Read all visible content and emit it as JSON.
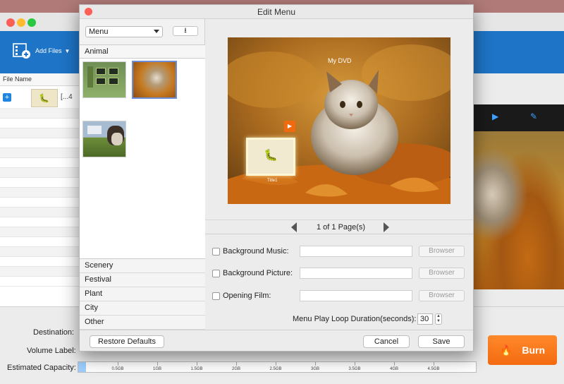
{
  "dialog": {
    "title": "Edit Menu"
  },
  "app": {
    "add_files_label": "Add Files",
    "file_list_header": "File Name",
    "file_item_suffix": "[...4",
    "destination_label": "Destination:",
    "volume_label": "Volume Label:",
    "capacity_label": "Estimated Capacity:",
    "capacity_ticks": [
      "0.5GB",
      "1GB",
      "1.5GB",
      "2GB",
      "2.5GB",
      "3GB",
      "3.5GB",
      "4GB",
      "4.5GB"
    ],
    "capacity_used_fraction": 0.02,
    "burn_label": "Burn"
  },
  "themes": {
    "selector_value": "Menu",
    "current_category": "Animal",
    "categories": [
      "Scenery",
      "Festival",
      "Plant",
      "City",
      "Other"
    ]
  },
  "preview": {
    "title": "My DVD",
    "title_label": "Title1",
    "page_text": "1 of 1 Page(s)"
  },
  "options": {
    "background_music": "Background Music:",
    "background_picture": "Background Picture:",
    "opening_film": "Opening Film:",
    "browse_label": "Browser",
    "loop_label": "Menu Play Loop Duration(seconds):",
    "loop_value": "30"
  },
  "footer": {
    "restore": "Restore Defaults",
    "cancel": "Cancel",
    "save": "Save"
  },
  "colors": {
    "toolbar_blue": "#1e74c6",
    "burn_orange": "#f46a10",
    "selection_blue": "#6c8ed8"
  }
}
